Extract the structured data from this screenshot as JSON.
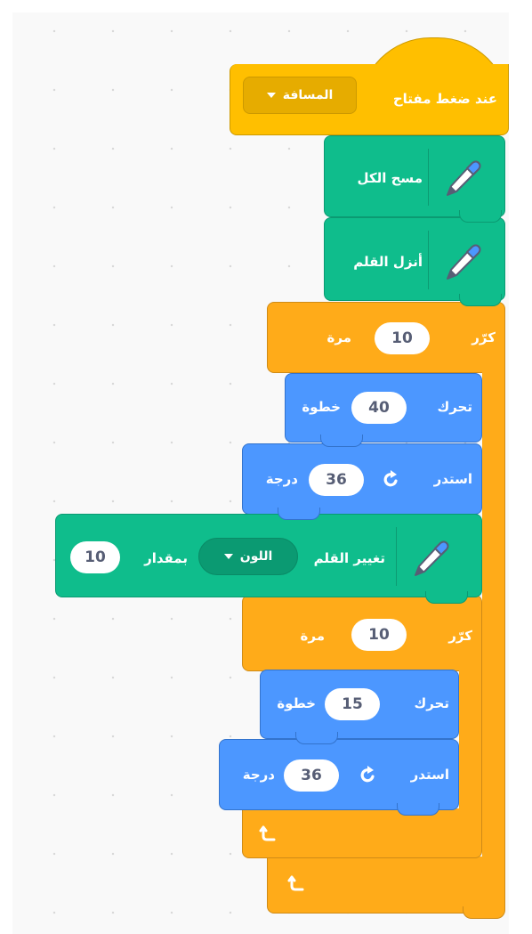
{
  "hat": {
    "label": "عند ضغط مفتاح",
    "key_value": "المسافة"
  },
  "pen_clear": {
    "label": "مسح الكل"
  },
  "pen_down": {
    "label": "أنزل القلم"
  },
  "repeat1": {
    "label": "كرّر",
    "count": "10",
    "suffix": "مرة"
  },
  "move1": {
    "label": "تحرك",
    "steps": "40",
    "suffix": "خطوة"
  },
  "turn1": {
    "label": "استدر",
    "degrees": "36",
    "suffix": "درجة"
  },
  "pen_change": {
    "label": "تغيير القلم",
    "param": "اللون",
    "by": "بمقدار",
    "amount": "10"
  },
  "repeat2": {
    "label": "كرّر",
    "count": "10",
    "suffix": "مرة"
  },
  "move2": {
    "label": "تحرك",
    "steps": "15",
    "suffix": "خطوة"
  },
  "turn2": {
    "label": "استدر",
    "degrees": "36",
    "suffix": "درجة"
  },
  "colors": {
    "events": "#ffbf00",
    "pen": "#0fbd8c",
    "control": "#ffab19",
    "motion": "#4c97ff",
    "input_text": "#575e75"
  },
  "icons": {
    "pen": "pen-icon",
    "turn": "rotate-right-icon",
    "loop_end": "loop-arrow-icon",
    "dropdown": "caret-down-icon"
  }
}
